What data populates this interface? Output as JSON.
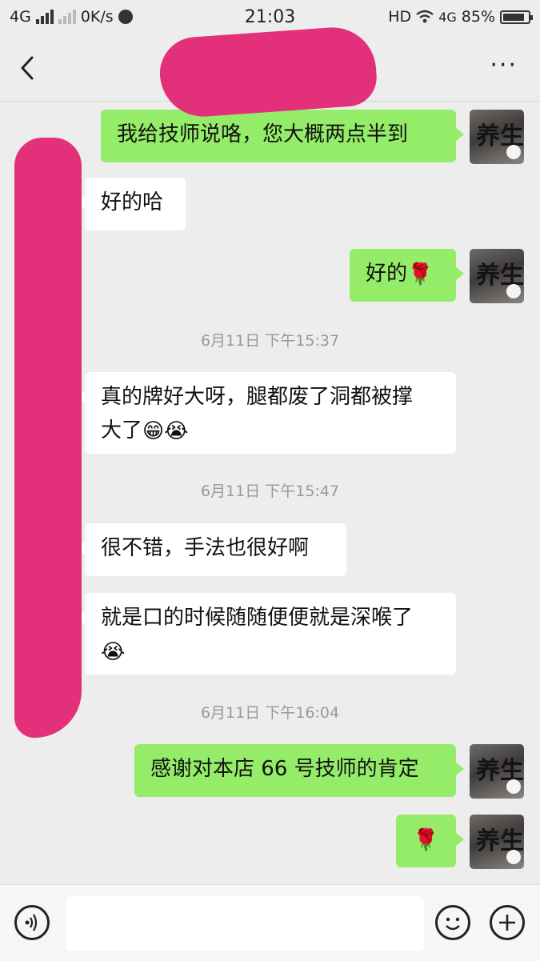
{
  "status_bar": {
    "network_left": "4G",
    "speed": "0K/s",
    "time": "21:03",
    "hd": "HD",
    "network_right": "4G",
    "battery_text": "85%",
    "battery_level": 0.85
  },
  "nav": {
    "back_icon": "chevron-left-icon",
    "more_icon": "more-dots-icon",
    "more_label": "···"
  },
  "messages": [
    {
      "from": "me",
      "text": "我给技师说咯，您大概两点半到"
    },
    {
      "from": "other",
      "text": "好的哈"
    },
    {
      "from": "me",
      "text": "好的",
      "emoji": "🌹"
    },
    {
      "type": "timestamp",
      "text": "6月11日 下午15:37"
    },
    {
      "from": "other",
      "text_line1": "真的牌好大呀，腿都废了洞都被撑",
      "text_line2": "大了",
      "emoji": "😁😭"
    },
    {
      "type": "timestamp",
      "text": "6月11日 下午15:47"
    },
    {
      "from": "other",
      "text": "很不错，手法也很好啊"
    },
    {
      "from": "other",
      "text_line1": "就是口的时候随随便便就是深喉了",
      "emoji": "😭"
    },
    {
      "type": "timestamp",
      "text": "6月11日 下午16:04"
    },
    {
      "from": "me",
      "text": "感谢对本店 66 号技师的肯定"
    },
    {
      "from": "me",
      "emoji": "🌹"
    }
  ],
  "avatar": {
    "me_glyph": "养生"
  },
  "input_bar": {
    "voice_icon": "voice-icon",
    "emoji_icon": "emoji-icon",
    "plus_icon": "plus-icon",
    "placeholder": ""
  },
  "colors": {
    "out_bubble": "#95ec69",
    "in_bubble": "#ffffff",
    "background": "#ededed",
    "redaction": "#e2307a"
  }
}
